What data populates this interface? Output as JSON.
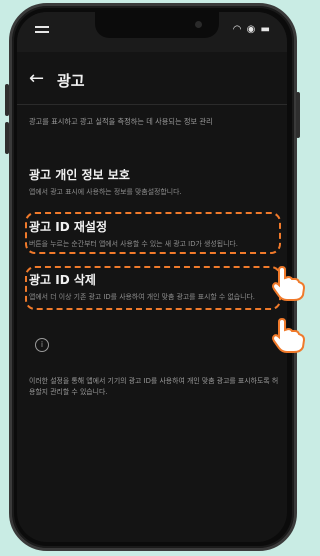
{
  "status": {
    "icons": [
      "wifi-icon",
      "dnd-icon",
      "battery-icon"
    ]
  },
  "appbar": {
    "back_icon": "←",
    "title": "광고"
  },
  "description": "광고를 표시하고 광고 실적을 측정하는 데 사용되는 정보 관리",
  "settings": [
    {
      "title": "광고 개인 정보 보호",
      "subtitle": "앱에서 광고 표시에 사용하는 정보를 맞춤설정합니다."
    },
    {
      "title": "광고 ID 재설정",
      "subtitle": "버튼을 누르는 순간부터 앱에서 사용할 수 있는 새 광고 ID가 생성됩니다."
    },
    {
      "title": "광고 ID 삭제",
      "subtitle": "앱에서 더 이상 기존 광고 ID를 사용하여 개인 맞춤 광고를 표시할 수 없습니다."
    }
  ],
  "info": {
    "icon": "i",
    "text": "이러한 설정을 통해 앱에서 기기의 광고 ID를 사용하여 개인 맞춤 광고를 표시하도록 허용할지 관리할 수 있습니다."
  },
  "colors": {
    "highlight": "#f07a2b",
    "background": "#c9ece4",
    "screen": "#141414"
  }
}
